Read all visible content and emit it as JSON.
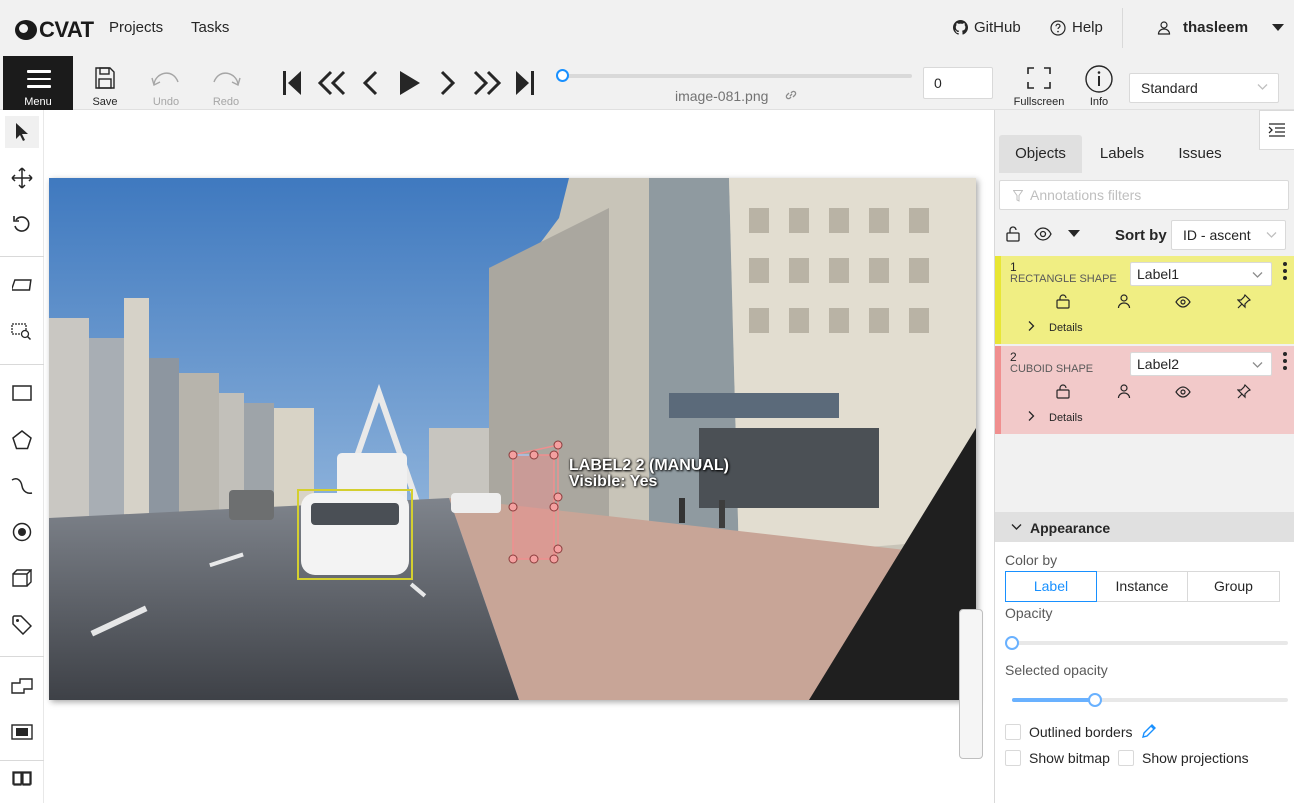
{
  "header": {
    "logo_text": "CVAT",
    "nav": [
      {
        "label": "Projects"
      },
      {
        "label": "Tasks"
      }
    ],
    "github_label": "GitHub",
    "help_label": "Help",
    "user_name": "thasleem"
  },
  "toolbar": {
    "menu_label": "Menu",
    "save_label": "Save",
    "undo_label": "Undo",
    "redo_label": "Redo",
    "filename": "image-081.png",
    "frame_value": "0",
    "fullscreen_label": "Fullscreen",
    "info_label": "Info",
    "workspace": "Standard"
  },
  "canvas": {
    "shape_label_line1": "LABEL2 2 (MANUAL)",
    "shape_label_line2": "Visible: Yes"
  },
  "sidebar": {
    "tabs": [
      {
        "label": "Objects"
      },
      {
        "label": "Labels"
      },
      {
        "label": "Issues"
      }
    ],
    "filter_placeholder": "Annotations filters",
    "sort_label": "Sort by",
    "sort_value": "ID - ascent",
    "objects": [
      {
        "id": "1",
        "type": "RECTANGLE SHAPE",
        "label": "Label1",
        "details": "Details",
        "color": "#f0ee83"
      },
      {
        "id": "2",
        "type": "CUBOID SHAPE",
        "label": "Label2",
        "details": "Details",
        "color": "#f2c9c9"
      }
    ]
  },
  "appearance": {
    "title": "Appearance",
    "color_by_label": "Color by",
    "color_by_options": [
      "Label",
      "Instance",
      "Group"
    ],
    "color_by_selected": "Label",
    "opacity_label": "Opacity",
    "opacity": 0.0,
    "selected_opacity_label": "Selected opacity",
    "selected_opacity": 0.3,
    "outlined_borders_label": "Outlined borders",
    "show_bitmap_label": "Show bitmap",
    "show_projections_label": "Show projections"
  },
  "colors": {
    "accent": "#1890ff",
    "label1": "#e8e635",
    "label2": "#f08f8f"
  }
}
